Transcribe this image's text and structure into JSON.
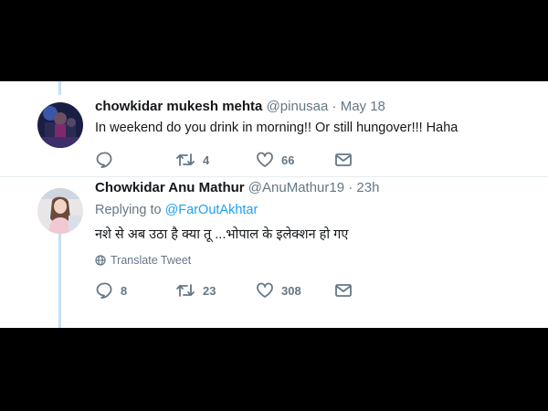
{
  "tweets": [
    {
      "display_name": "chowkidar mukesh mehta",
      "handle": "@pinusaa",
      "sep": "·",
      "time": "May 18",
      "text": "In weekend do you drink in morning!! Or still hungover!!! Haha",
      "retweets": "4",
      "likes": "66"
    },
    {
      "display_name": "Chowkidar Anu Mathur",
      "handle": "@AnuMathur19",
      "sep": "·",
      "time": "23h",
      "replying_label": "Replying to",
      "replying_handle": "@FarOutAkhtar",
      "text": "नशे से अब उठा है क्या तू ...भोपाल के इलेक्शन हो गए",
      "translate_label": "Translate Tweet",
      "replies": "8",
      "retweets": "23",
      "likes": "308"
    }
  ],
  "colors": {
    "accent": "#1da1f2",
    "muted": "#657786",
    "thread": "#c4e0f5"
  }
}
